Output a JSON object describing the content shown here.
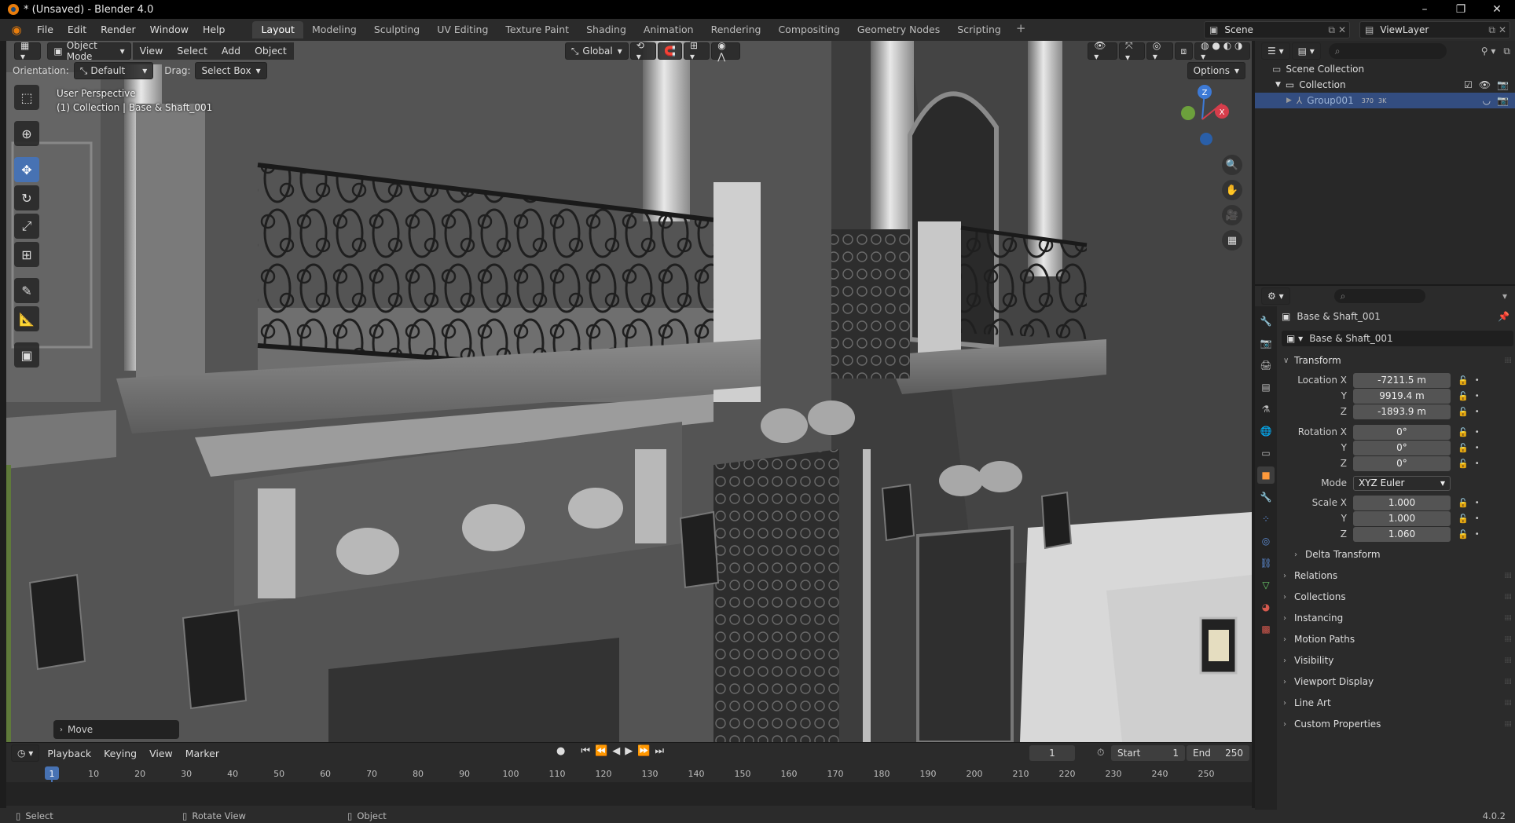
{
  "window": {
    "title": "* (Unsaved) - Blender 4.0",
    "controls": [
      "–",
      "❐",
      "✕"
    ]
  },
  "menu": {
    "items": [
      "File",
      "Edit",
      "Render",
      "Window",
      "Help"
    ]
  },
  "workspaces": {
    "tabs": [
      "Layout",
      "Modeling",
      "Sculpting",
      "UV Editing",
      "Texture Paint",
      "Shading",
      "Animation",
      "Rendering",
      "Compositing",
      "Geometry Nodes",
      "Scripting"
    ],
    "active": "Layout",
    "add": "+"
  },
  "scene": {
    "name": "Scene",
    "view_layer": "ViewLayer"
  },
  "viewport": {
    "mode": "Object Mode",
    "menus": [
      "View",
      "Select",
      "Add",
      "Object"
    ],
    "transform_orientation": "Global",
    "orientation_label": "Orientation:",
    "orientation_value": "Default",
    "drag_label": "Drag:",
    "drag_value": "Select Box",
    "options": "Options",
    "info_line1": "User Perspective",
    "info_line2": "(1) Collection | Base & Shaft_001",
    "last_operator": "Move",
    "gizmo": {
      "z": "Z",
      "x": "X"
    }
  },
  "timeline": {
    "menus": [
      "Playback",
      "Keying",
      "View",
      "Marker"
    ],
    "current_frame": "1",
    "start_label": "Start",
    "start_value": "1",
    "end_label": "End",
    "end_value": "250",
    "ticks": [
      "1",
      "10",
      "20",
      "30",
      "40",
      "50",
      "60",
      "70",
      "80",
      "90",
      "100",
      "110",
      "120",
      "130",
      "140",
      "150",
      "160",
      "170",
      "180",
      "190",
      "200",
      "210",
      "220",
      "230",
      "240",
      "250"
    ]
  },
  "statusbar": {
    "select": "Select",
    "rotate": "Rotate View",
    "object": "Object",
    "version": "4.0.2"
  },
  "outliner": {
    "scene_collection": "Scene Collection",
    "collection": "Collection",
    "group": "Group001",
    "group_badge": "370",
    "group_badge2": "3K"
  },
  "properties": {
    "object_name": "Base & Shaft_001",
    "data_name": "Base & Shaft_001",
    "transform_title": "Transform",
    "location_label": "Location X",
    "location": {
      "x": "-7211.5 m",
      "y": "9919.4 m",
      "z": "-1893.9 m"
    },
    "rotation_label": "Rotation X",
    "rotation": {
      "x": "0°",
      "y": "0°",
      "z": "0°"
    },
    "mode_label": "Mode",
    "mode_value": "XYZ Euler",
    "scale_label": "Scale X",
    "scale": {
      "x": "1.000",
      "y": "1.000",
      "z": "1.060"
    },
    "axis_y": "Y",
    "axis_z": "Z",
    "delta_transform": "Delta Transform",
    "panels": [
      "Relations",
      "Collections",
      "Instancing",
      "Motion Paths",
      "Visibility",
      "Viewport Display",
      "Line Art",
      "Custom Properties"
    ]
  },
  "colors": {
    "accent": "#4772b3",
    "selection": "#334d80",
    "frame_marker": "#4772b3",
    "orange": "#e87d0d"
  }
}
